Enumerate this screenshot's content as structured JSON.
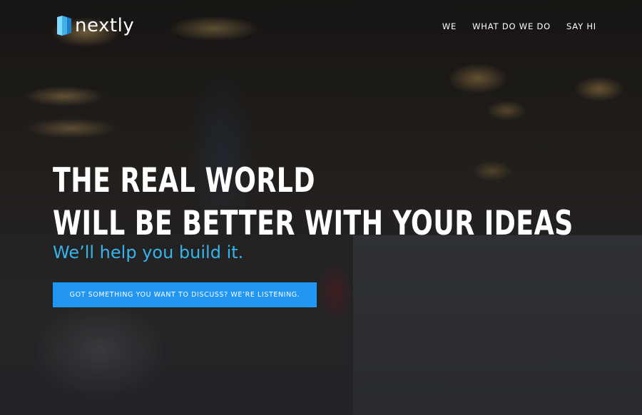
{
  "brand": {
    "name": "nextly",
    "logo_icon": "nextly-logo-icon",
    "logo_colors": {
      "light": "#7fdcff",
      "mid": "#3fb1e8",
      "dark": "#1f7fc6"
    }
  },
  "nav": {
    "items": [
      {
        "label": "WE"
      },
      {
        "label": "WHAT DO WE DO"
      },
      {
        "label": "SAY HI"
      }
    ]
  },
  "hero": {
    "headline_line1": "THE REAL WORLD",
    "headline_line2": "WILL BE BETTER WITH YOUR IDEAS",
    "subtitle": "We’ll help you build it.",
    "cta_label": "GOT SOMETHING YOU WANT TO DISCUSS? WE’RE LISTENING."
  },
  "colors": {
    "accent": "#2196f3",
    "subtitle": "#35b4ec",
    "text": "#ffffff"
  }
}
